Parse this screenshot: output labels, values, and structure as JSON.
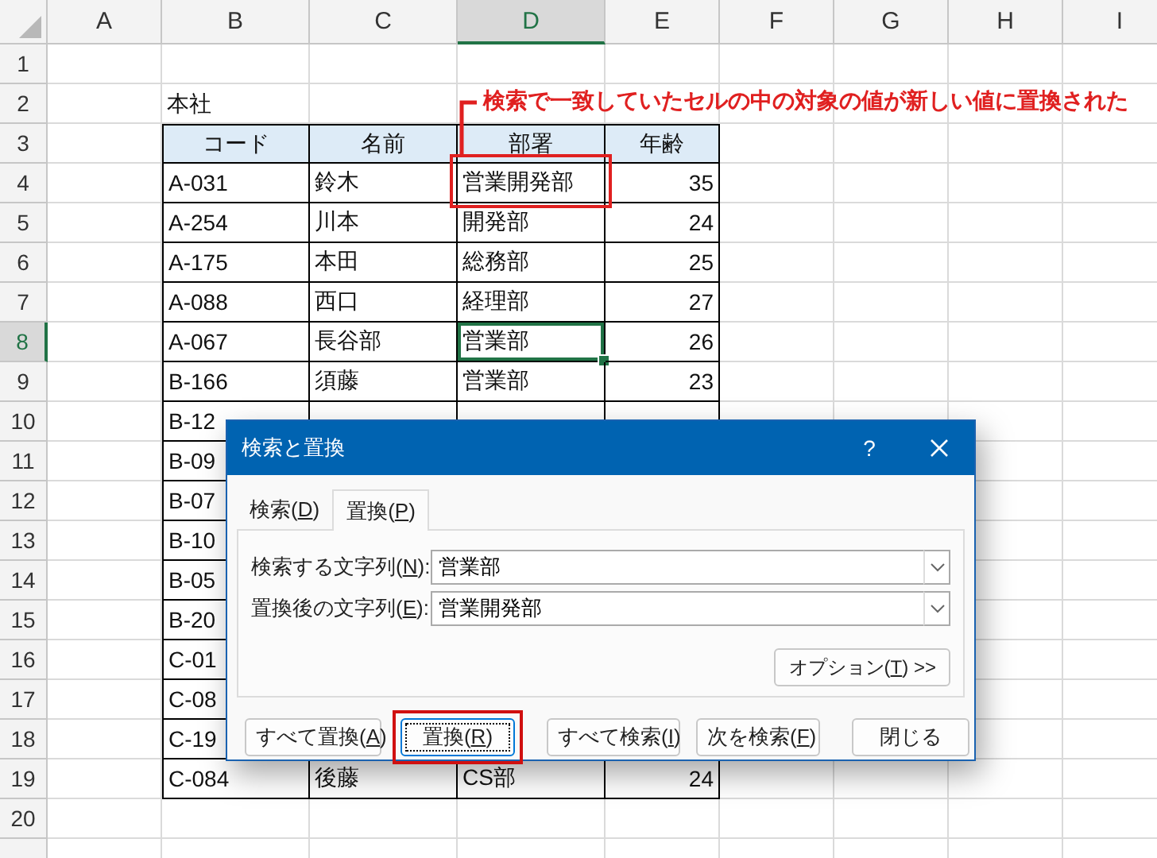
{
  "sheet": {
    "columns": [
      {
        "label": "A",
        "selected": false
      },
      {
        "label": "B",
        "selected": false
      },
      {
        "label": "C",
        "selected": false
      },
      {
        "label": "D",
        "selected": true
      },
      {
        "label": "E",
        "selected": false
      },
      {
        "label": "F",
        "selected": false
      },
      {
        "label": "G",
        "selected": false
      },
      {
        "label": "H",
        "selected": false
      },
      {
        "label": "I",
        "selected": false
      }
    ],
    "rows": [
      {
        "number": "1",
        "selected": false,
        "kind": "empty",
        "cells": []
      },
      {
        "number": "2",
        "selected": false,
        "kind": "label",
        "cells": [
          "",
          "本社"
        ]
      },
      {
        "number": "3",
        "selected": false,
        "kind": "header",
        "cells": [
          "",
          "コード",
          "名前",
          "部署",
          "年齢"
        ]
      },
      {
        "number": "4",
        "selected": false,
        "kind": "data",
        "cells": [
          "",
          "A-031",
          "鈴木",
          "営業開発部",
          "35"
        ]
      },
      {
        "number": "5",
        "selected": false,
        "kind": "data",
        "cells": [
          "",
          "A-254",
          "川本",
          "開発部",
          "24"
        ]
      },
      {
        "number": "6",
        "selected": false,
        "kind": "data",
        "cells": [
          "",
          "A-175",
          "本田",
          "総務部",
          "25"
        ]
      },
      {
        "number": "7",
        "selected": false,
        "kind": "data",
        "cells": [
          "",
          "A-088",
          "西口",
          "経理部",
          "27"
        ]
      },
      {
        "number": "8",
        "selected": true,
        "kind": "data",
        "cells": [
          "",
          "A-067",
          "長谷部",
          "営業部",
          "26"
        ]
      },
      {
        "number": "9",
        "selected": false,
        "kind": "data",
        "cells": [
          "",
          "B-166",
          "須藤",
          "営業部",
          "23"
        ]
      },
      {
        "number": "10",
        "selected": false,
        "kind": "data",
        "cells": [
          "",
          "B-12"
        ]
      },
      {
        "number": "11",
        "selected": false,
        "kind": "data",
        "cells": [
          "",
          "B-09"
        ]
      },
      {
        "number": "12",
        "selected": false,
        "kind": "data",
        "cells": [
          "",
          "B-07"
        ]
      },
      {
        "number": "13",
        "selected": false,
        "kind": "data",
        "cells": [
          "",
          "B-10"
        ]
      },
      {
        "number": "14",
        "selected": false,
        "kind": "data",
        "cells": [
          "",
          "B-05"
        ]
      },
      {
        "number": "15",
        "selected": false,
        "kind": "data",
        "cells": [
          "",
          "B-20"
        ]
      },
      {
        "number": "16",
        "selected": false,
        "kind": "data",
        "cells": [
          "",
          "C-01"
        ]
      },
      {
        "number": "17",
        "selected": false,
        "kind": "data",
        "cells": [
          "",
          "C-08"
        ]
      },
      {
        "number": "18",
        "selected": false,
        "kind": "data",
        "cells": [
          "",
          "C-19"
        ]
      },
      {
        "number": "19",
        "selected": false,
        "kind": "data",
        "cells": [
          "",
          "C-084",
          "後藤",
          "CS部",
          "24"
        ]
      },
      {
        "number": "20",
        "selected": false,
        "kind": "empty",
        "cells": []
      }
    ]
  },
  "callout": {
    "text": "検索で一致していたセルの中の対象の値が新しい値に置換された"
  },
  "dialog": {
    "title": "検索と置換",
    "help": "?",
    "tabs": [
      {
        "label": "検索(D)",
        "selected": false
      },
      {
        "label": "置換(P)",
        "selected": true
      }
    ],
    "fields": [
      {
        "label": "検索する文字列(N):",
        "value": "営業部"
      },
      {
        "label": "置換後の文字列(E):",
        "value": "営業開発部"
      }
    ],
    "options_button": "オプション(T) >>",
    "buttons": [
      {
        "label": "すべて置換(A)",
        "focused": false,
        "annotated": false
      },
      {
        "label": "置換(R)",
        "focused": true,
        "annotated": true
      },
      {
        "label": "すべて検索(I)",
        "focused": false,
        "annotated": false
      },
      {
        "label": "次を検索(F)",
        "focused": false,
        "annotated": false
      },
      {
        "label": "閉じる",
        "focused": false,
        "annotated": false
      }
    ]
  }
}
